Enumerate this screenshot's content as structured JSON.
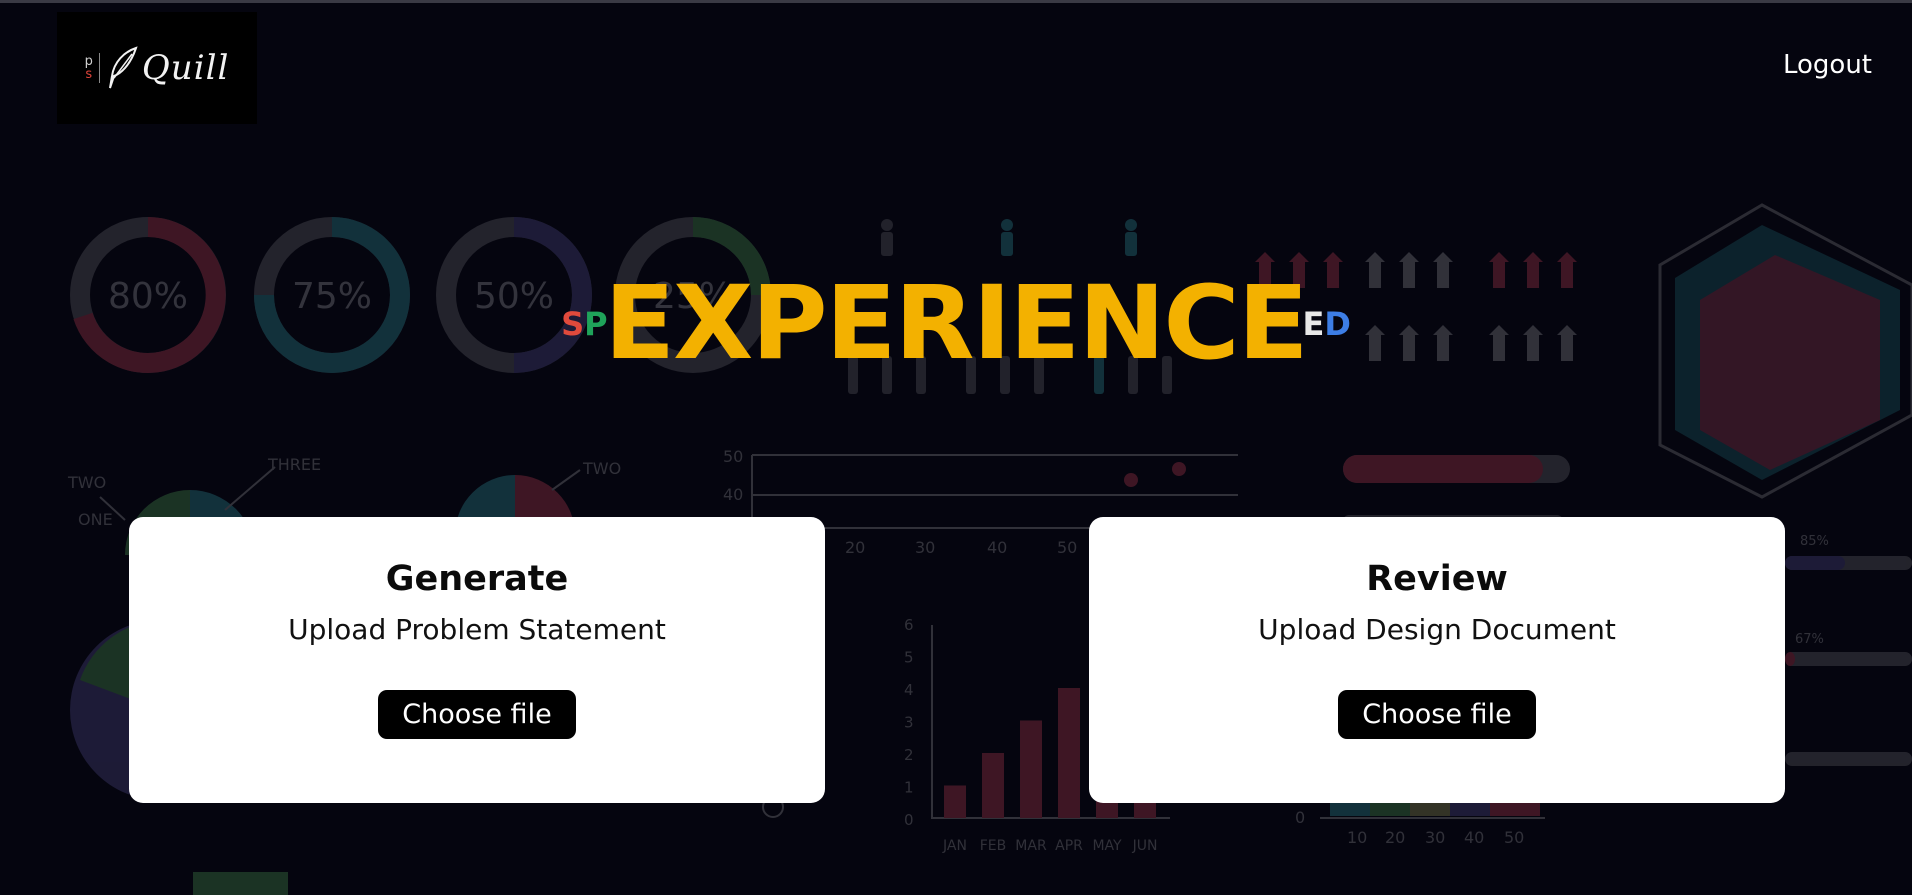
{
  "header": {
    "logo": {
      "letter_p": "p",
      "letter_s": "s",
      "wordmark": "Quill"
    },
    "logout_label": "Logout"
  },
  "hero": {
    "prefix_s": "S",
    "prefix_p": "P",
    "main": "EXPERIENCE",
    "suffix_e": "E",
    "suffix_d": "D"
  },
  "cards": {
    "generate": {
      "title": "Generate",
      "subtitle": "Upload Problem Statement",
      "button": "Choose file"
    },
    "review": {
      "title": "Review",
      "subtitle": "Upload Design Document",
      "button": "Choose file"
    }
  },
  "background": {
    "donuts": [
      "80%",
      "75%",
      "50%",
      "25%"
    ],
    "bar_chart": {
      "categories": [
        "JAN",
        "FEB",
        "MAR",
        "APR",
        "MAY",
        "JUN"
      ],
      "y_ticks": [
        "6",
        "5",
        "4",
        "3",
        "2",
        "1",
        "0"
      ],
      "values": [
        1,
        2,
        3,
        4,
        1,
        1
      ]
    },
    "scatter_ticks_y": [
      "50",
      "40"
    ],
    "scatter_ticks_x": [
      "20",
      "30",
      "40",
      "50"
    ],
    "pie_labels": [
      "TWO",
      "THREE",
      "ONE",
      "TWO"
    ],
    "bottom_ticks_x": [
      "0",
      "10",
      "20",
      "30",
      "40",
      "50"
    ],
    "percent_tags": [
      "85%",
      "67%"
    ]
  }
}
